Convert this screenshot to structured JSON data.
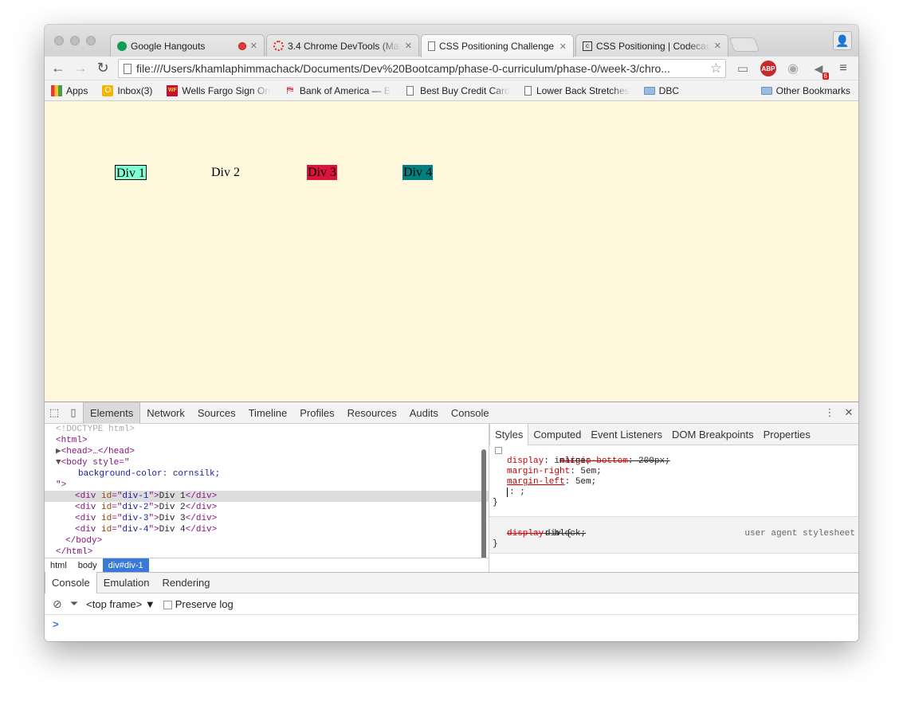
{
  "colors": {
    "page_background": "#fff8dc",
    "div1_background": "#7fffd4",
    "div3_background": "#dc143c",
    "div4_background": "#008080",
    "selection_blue": "#3879d9"
  },
  "tabs": [
    {
      "title": "Google Hangouts",
      "icon": "hangouts-icon"
    },
    {
      "title": "3.4 Chrome DevTools (Man",
      "icon": "devtools-loading-icon"
    },
    {
      "title": "CSS Positioning Challenge",
      "icon": "page-icon"
    },
    {
      "title": "CSS Positioning | Codecad",
      "icon": "codecademy-icon"
    }
  ],
  "toolbar": {
    "url": "file:///Users/khamlaphimmachack/Documents/Dev%20Bootcamp/phase-0-curriculum/phase-0/week-3/chro...",
    "ext_abp_label": "ABP",
    "ext_badge": "6"
  },
  "bookmarks": [
    {
      "label": "Apps",
      "icon": "apps-grid-icon"
    },
    {
      "label": "Inbox(3)",
      "icon": "inbox-icon"
    },
    {
      "label": "Wells Fargo Sign On",
      "icon": "wells-fargo-icon"
    },
    {
      "label": "Bank of America — B",
      "icon": "boa-icon"
    },
    {
      "label": "Best Buy Credit Card",
      "icon": "page-icon"
    },
    {
      "label": "Lower Back Stretches",
      "icon": "page-icon"
    },
    {
      "label": "DBC",
      "icon": "folder-icon"
    }
  ],
  "other_bookmarks": "Other Bookmarks",
  "page": {
    "divs": [
      "Div 1",
      "Div 2",
      "Div 3",
      "Div 4"
    ]
  },
  "devtools": {
    "tabs": [
      "Elements",
      "Network",
      "Sources",
      "Timeline",
      "Profiles",
      "Resources",
      "Audits",
      "Console"
    ],
    "active_tab": "Elements",
    "styles_tabs": [
      "Styles",
      "Computed",
      "Event Listeners",
      "DOM Breakpoints",
      "Properties"
    ],
    "breadcrumbs": [
      "html",
      "body",
      "div#div-1"
    ],
    "drawer_tabs": [
      "Console",
      "Emulation",
      "Rendering"
    ],
    "frame_select": "<top frame>",
    "preserve_log": "Preserve log",
    "prompt": ">",
    "elements_lines": {
      "doctype": "<!DOCTYPE html>",
      "html_open": "<html>",
      "head": "<head>…</head>",
      "body_open": "<body style=\"",
      "body_style": "background-color: cornsilk;",
      "body_close_attr": "\">",
      "div1_id": "div-1",
      "div2_id": "div-2",
      "div3_id": "div-3",
      "div4_id": "div-4",
      "div1_text": "Div 1",
      "div2_text": "Div 2",
      "div3_text": "Div 3",
      "div4_text": "Div 4",
      "body_end": "</body>",
      "html_end": "</html>"
    },
    "styles": {
      "p1_name": "margin-bottom",
      "p1_val": "200px",
      "p2_name": "display",
      "p2_val": "inline",
      "p3_name": "margin-right",
      "p3_val": "5em",
      "p4_name": "margin-left",
      "p4_val": "5em",
      "empty_prop": ": ;",
      "close_brace": "}",
      "ua_selector": "div {",
      "ua_label": "user agent stylesheet",
      "ua_prop_name": "display",
      "ua_prop_val": "block"
    }
  }
}
